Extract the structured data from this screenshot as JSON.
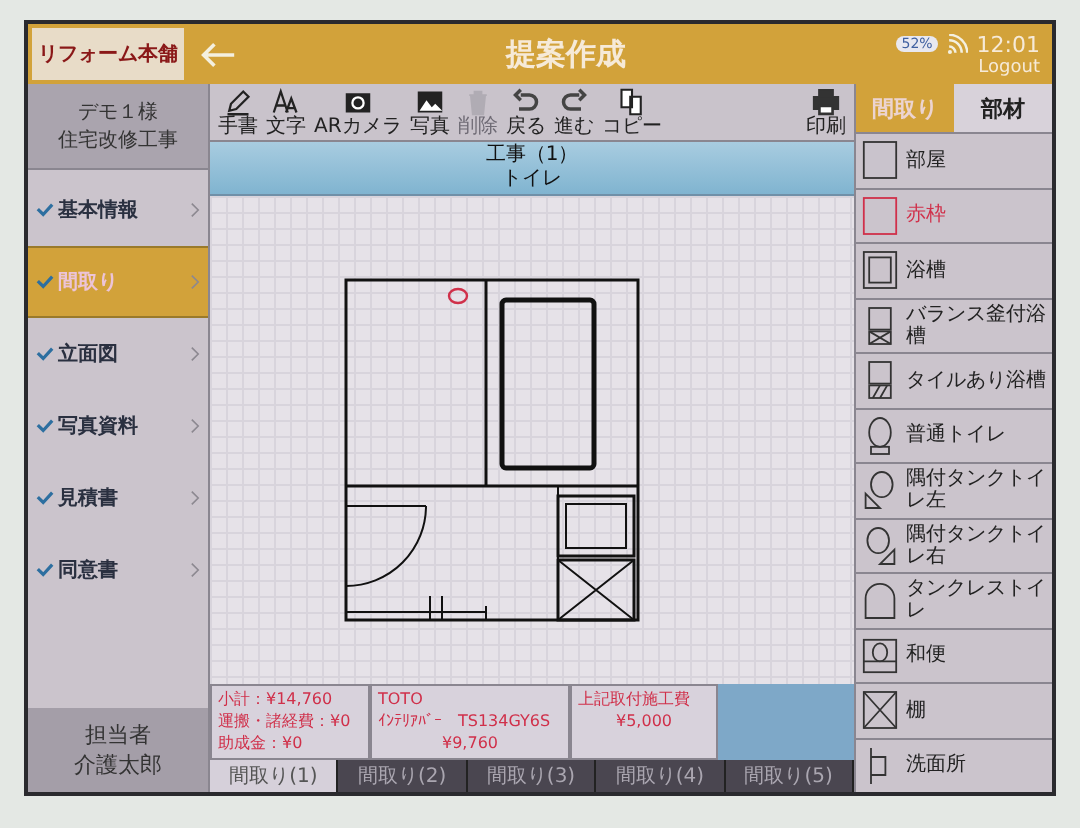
{
  "header": {
    "logo": "リフォーム本舗",
    "title": "提案作成",
    "battery": "52%",
    "time": "12:01",
    "logout": "Logout"
  },
  "sidebar": {
    "project": [
      "デモ１様",
      "住宅改修工事"
    ],
    "items": [
      {
        "label": "基本情報",
        "checked": true,
        "selected": false
      },
      {
        "label": "間取り",
        "checked": true,
        "selected": true
      },
      {
        "label": "立面図",
        "checked": true,
        "selected": false
      },
      {
        "label": "写真資料",
        "checked": true,
        "selected": false
      },
      {
        "label": "見積書",
        "checked": true,
        "selected": false
      },
      {
        "label": "同意書",
        "checked": true,
        "selected": false
      }
    ],
    "person": [
      "担当者",
      "介護太郎"
    ]
  },
  "toolbar": [
    {
      "kind": "pen",
      "label": "手書",
      "disabled": false
    },
    {
      "kind": "text",
      "label": "文字",
      "disabled": false
    },
    {
      "kind": "camera",
      "label": "ARカメラ",
      "disabled": false
    },
    {
      "kind": "photo",
      "label": "写真",
      "disabled": false
    },
    {
      "kind": "trash",
      "label": "削除",
      "disabled": true
    },
    {
      "kind": "undo",
      "label": "戻る",
      "disabled": false
    },
    {
      "kind": "redo",
      "label": "進む",
      "disabled": false
    },
    {
      "kind": "copy",
      "label": "コピー",
      "disabled": false
    },
    {
      "kind": "print",
      "label": "印刷",
      "disabled": false
    }
  ],
  "canvas": {
    "title": [
      "工事（1）",
      "トイレ"
    ]
  },
  "summary": [
    {
      "lines": [
        "小計：¥14,760",
        "運搬・諸経費：¥0",
        "助成金：¥0"
      ],
      "color": "#d0304a"
    },
    {
      "lines": [
        "TOTO",
        "ｲﾝﾃﾘｱﾊﾞｰ　TS134GY6S",
        "¥9,760"
      ],
      "color": "#d0304a"
    },
    {
      "lines": [
        "上記取付施工費",
        "¥5,000"
      ],
      "color": "#d0304a"
    }
  ],
  "page_tabs": [
    {
      "label": "間取り(1)",
      "selected": true
    },
    {
      "label": "間取り(2)",
      "selected": false
    },
    {
      "label": "間取り(3)",
      "selected": false
    },
    {
      "label": "間取り(4)",
      "selected": false
    },
    {
      "label": "間取り(5)",
      "selected": false
    }
  ],
  "panel": {
    "tabs": [
      {
        "label": "間取り",
        "selected": true
      },
      {
        "label": "部材",
        "selected": false
      }
    ],
    "items": [
      {
        "kind": "room",
        "label": "部屋",
        "color": "#222222"
      },
      {
        "kind": "red-frame",
        "label": "赤枠",
        "color": "#d0304a"
      },
      {
        "kind": "bath",
        "label": "浴槽",
        "color": "#222222"
      },
      {
        "kind": "balance-bath",
        "label": "バランス釜付浴槽",
        "color": "#222222"
      },
      {
        "kind": "tile-bath",
        "label": "タイルあり浴槽",
        "color": "#222222"
      },
      {
        "kind": "toilet",
        "label": "普通トイレ",
        "color": "#222222"
      },
      {
        "kind": "corner-left",
        "label": "隅付タンクトイレ左",
        "color": "#222222"
      },
      {
        "kind": "corner-right",
        "label": "隅付タンクトイレ右",
        "color": "#222222"
      },
      {
        "kind": "tankless",
        "label": "タンクレストイレ",
        "color": "#222222"
      },
      {
        "kind": "japanese",
        "label": "和便",
        "color": "#222222"
      },
      {
        "kind": "shelf",
        "label": "棚",
        "color": "#222222"
      },
      {
        "kind": "washroom",
        "label": "洗面所",
        "color": "#222222"
      }
    ]
  }
}
